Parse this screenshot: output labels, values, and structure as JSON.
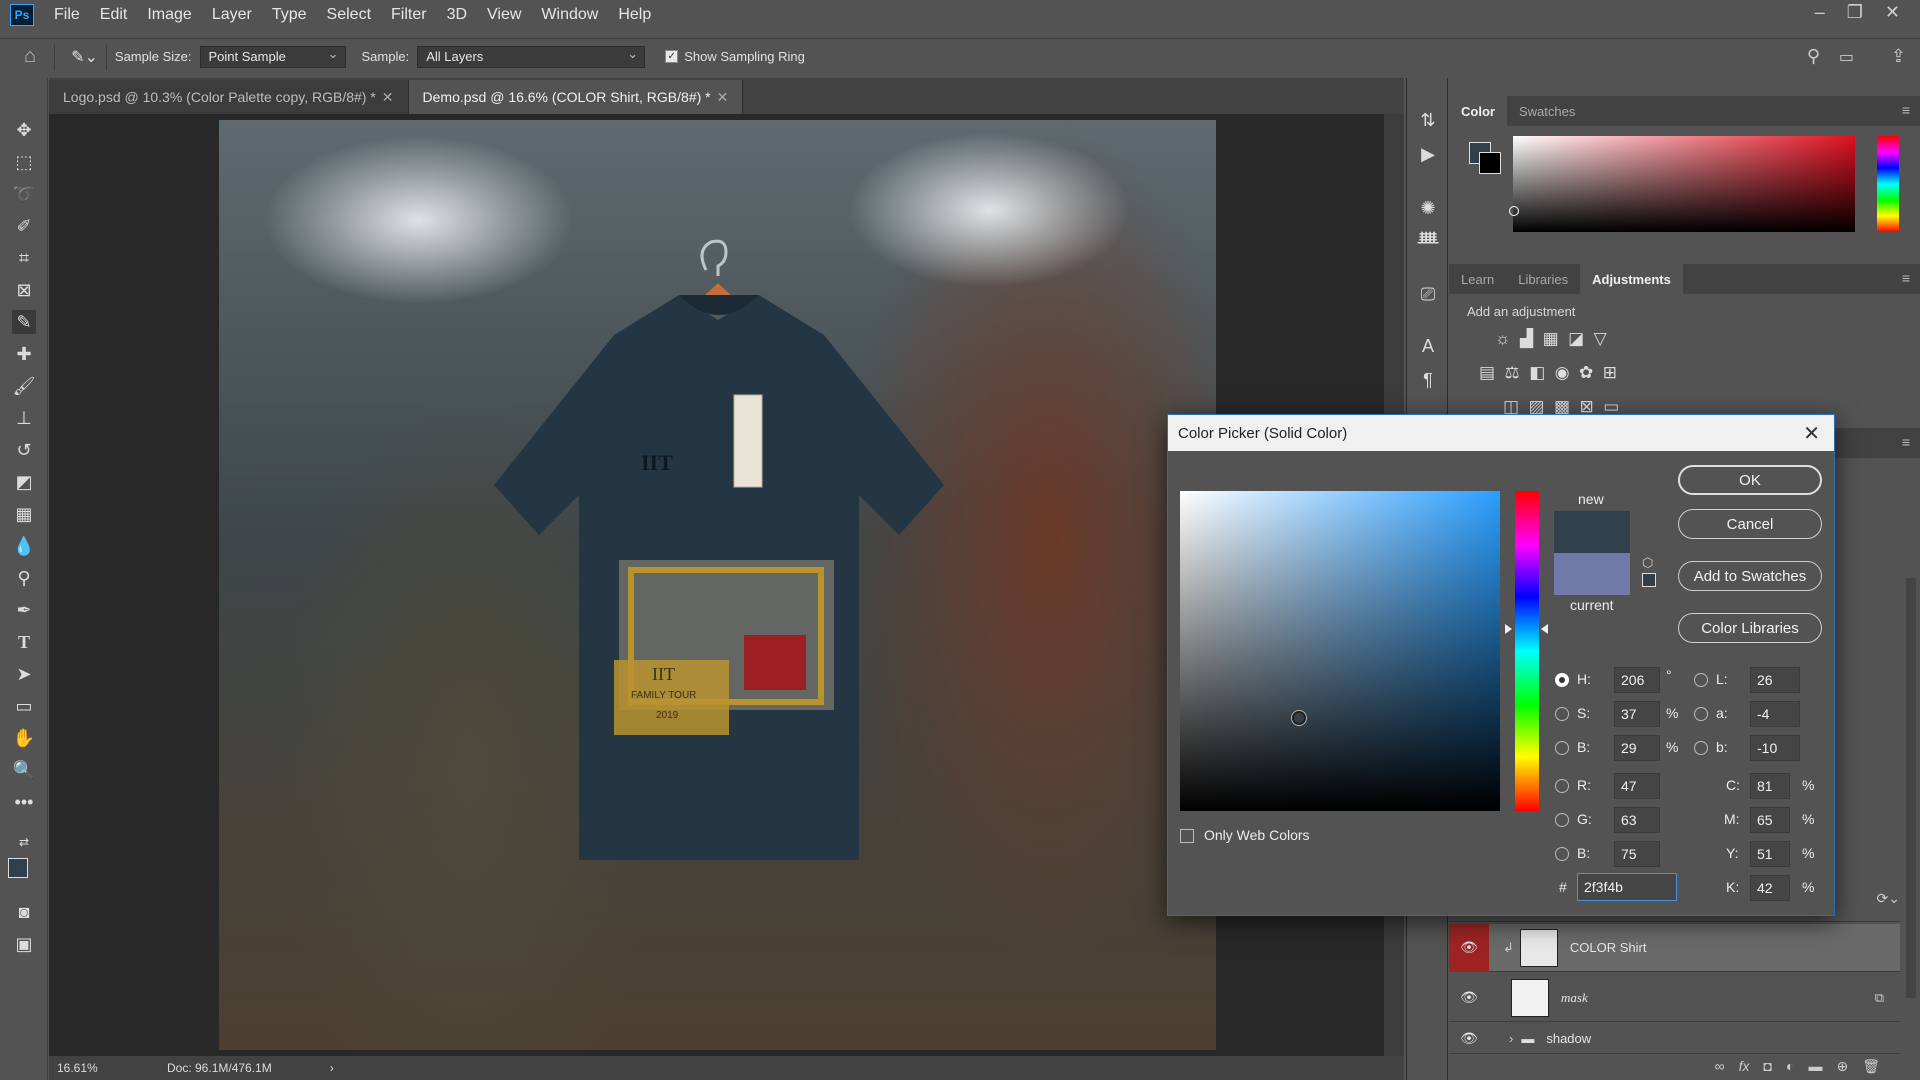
{
  "menubar": {
    "logo": "Ps",
    "items": [
      "File",
      "Edit",
      "Image",
      "Layer",
      "Type",
      "Select",
      "Filter",
      "3D",
      "View",
      "Window",
      "Help"
    ]
  },
  "options": {
    "sample_size_label": "Sample Size:",
    "sample_size_value": "Point Sample",
    "sample_label": "Sample:",
    "sample_value": "All Layers",
    "show_ring_label": "Show Sampling Ring",
    "show_ring_checked": true
  },
  "tabs": [
    {
      "label": "Logo.psd @ 10.3% (Color Palette copy, RGB/8#) *",
      "active": false
    },
    {
      "label": "Demo.psd @ 16.6% (COLOR Shirt, RGB/8#) *",
      "active": true
    }
  ],
  "status": {
    "zoom": "16.61%",
    "doc": "Doc: 96.1M/476.1M"
  },
  "color_panel": {
    "tabs": [
      "Color",
      "Swatches"
    ]
  },
  "adjust_panel": {
    "tabs": [
      "Learn",
      "Libraries",
      "Adjustments"
    ],
    "hint": "Add an adjustment"
  },
  "layers": [
    {
      "name": "COLOR Shirt",
      "visible": true,
      "selected": true
    },
    {
      "name": "mask",
      "visible": true,
      "selected": false
    },
    {
      "name": "shadow",
      "visible": true,
      "selected": false,
      "folder": true
    }
  ],
  "dialog": {
    "title": "Color Picker (Solid Color)",
    "new_label": "new",
    "current_label": "current",
    "buttons": {
      "ok": "OK",
      "cancel": "Cancel",
      "add_swatches": "Add to Swatches",
      "color_libraries": "Color Libraries"
    },
    "only_web_colors": "Only Web Colors",
    "fields": {
      "H": {
        "label": "H:",
        "value": "206",
        "unit": "°"
      },
      "S": {
        "label": "S:",
        "value": "37",
        "unit": "%"
      },
      "Bv": {
        "label": "B:",
        "value": "29",
        "unit": "%"
      },
      "R": {
        "label": "R:",
        "value": "47"
      },
      "G": {
        "label": "G:",
        "value": "63"
      },
      "Bc": {
        "label": "B:",
        "value": "75"
      },
      "L": {
        "label": "L:",
        "value": "26"
      },
      "a": {
        "label": "a:",
        "value": "-4"
      },
      "b": {
        "label": "b:",
        "value": "-10"
      },
      "C": {
        "label": "C:",
        "value": "81",
        "unit": "%"
      },
      "M": {
        "label": "M:",
        "value": "65",
        "unit": "%"
      },
      "Y": {
        "label": "Y:",
        "value": "51",
        "unit": "%"
      },
      "K": {
        "label": "K:",
        "value": "42",
        "unit": "%"
      }
    },
    "hash": "#",
    "hex": "2f3f4b",
    "new_color": "#2f3f4b",
    "current_color": "#6f7aa8"
  },
  "shirt_print": {
    "brand": "IIT",
    "tour_title": "IIT",
    "tour_line": "FAMILY TOUR",
    "year": "2019"
  }
}
